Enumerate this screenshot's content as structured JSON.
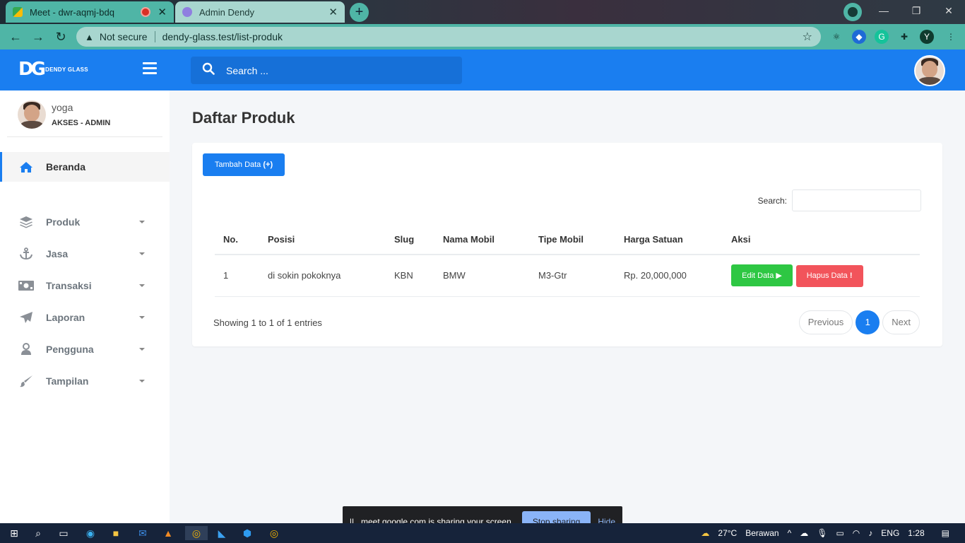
{
  "browser": {
    "tabs": [
      {
        "title": "Meet - dwr-aqmj-bdq"
      },
      {
        "title": "Admin Dendy"
      }
    ],
    "new_tab": "+",
    "omnibox": {
      "security": "Not secure",
      "url": "dendy-glass.test/list-produk"
    },
    "profile_initial": "Y"
  },
  "brand": {
    "logo_mark": "DG",
    "logo_text": "DENDY GLASS"
  },
  "header": {
    "search_placeholder": "Search ..."
  },
  "user": {
    "name": "yoga",
    "role": "AKSES - ADMIN"
  },
  "sidebar": {
    "items": [
      {
        "label": "Beranda"
      },
      {
        "label": "Produk"
      },
      {
        "label": "Jasa"
      },
      {
        "label": "Transaksi"
      },
      {
        "label": "Laporan"
      },
      {
        "label": "Pengguna"
      },
      {
        "label": "Tampilan"
      }
    ]
  },
  "page": {
    "title": "Daftar Produk",
    "add_button": "Tambah Data",
    "search_label": "Search:",
    "table": {
      "headers": [
        "No.",
        "Posisi",
        "Slug",
        "Nama Mobil",
        "Tipe Mobil",
        "Harga Satuan",
        "Aksi"
      ],
      "rows": [
        {
          "no": "1",
          "posisi": "di sokin pokoknya",
          "slug": "KBN",
          "nama_mobil": "BMW",
          "tipe_mobil": "M3-Gtr",
          "harga": "Rp. 20,000,000"
        }
      ],
      "edit_label": "Edit Data",
      "delete_label": "Hapus Data"
    },
    "entries_info": "Showing 1 to 1 of 1 entries",
    "pagination": {
      "previous": "Previous",
      "current": "1",
      "next": "Next"
    }
  },
  "share_bar": {
    "message": "meet.google.com is sharing your screen.",
    "stop": "Stop sharing",
    "hide": "Hide"
  },
  "taskbar": {
    "temperature": "27°C",
    "weather": "Berawan",
    "language": "ENG",
    "time": "1:28"
  },
  "colors": {
    "primary": "#1a7ef0",
    "success": "#2ec743",
    "danger": "#f2545b",
    "chrome": "#4fb5a6"
  }
}
